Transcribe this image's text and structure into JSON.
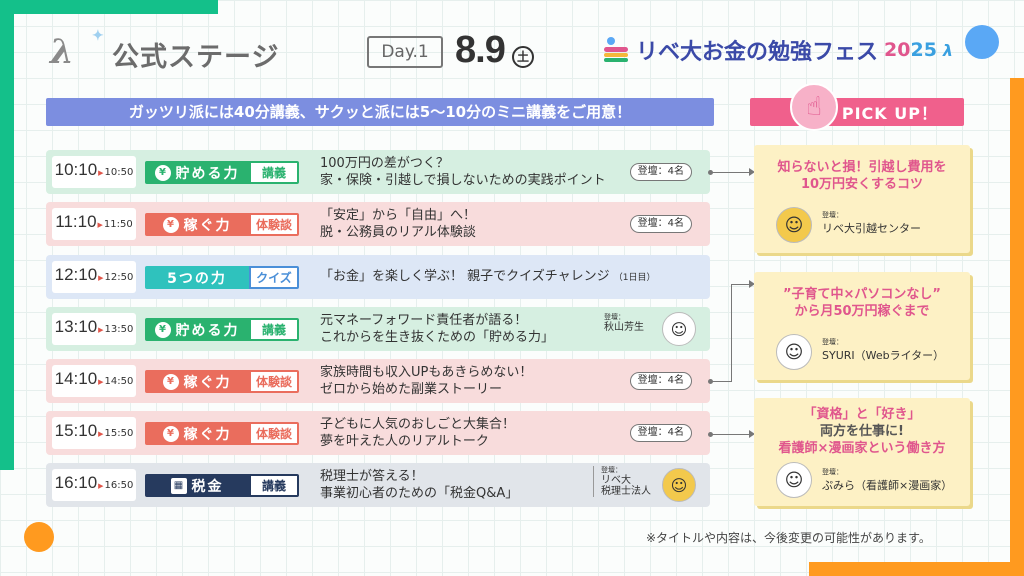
{
  "header": {
    "stage_title": "公式ステージ",
    "day_label": "Day.1",
    "date": "8.9",
    "weekday": "土",
    "festival_title": "リベ大お金の勉強フェス",
    "festival_year_a": "20",
    "festival_year_b": "25"
  },
  "banner": "ガッツリ派には40分講義、サクッと派には5〜10分のミニ講義をご用意！",
  "schedule": [
    {
      "start": "10:10",
      "end": "10:50",
      "category": "貯める力",
      "category_icon": "¥",
      "type": "講義",
      "title_line1": "100万円の差がつく？",
      "title_line2": "家・保険・引越しで損しないための実践ポイント",
      "speaker": "登壇：4名"
    },
    {
      "start": "11:10",
      "end": "11:50",
      "category": "稼ぐ力",
      "category_icon": "¥",
      "type": "体験談",
      "title_line1": "「安定」から「自由」へ！",
      "title_line2": "脱・公務員のリアル体験談",
      "speaker": "登壇：4名"
    },
    {
      "start": "12:10",
      "end": "12:50",
      "category": "5つの力",
      "type": "クイズ",
      "title_line1": "「お金」を楽しく学ぶ！ 親子でクイズチャレンジ",
      "title_note": "（1日目）"
    },
    {
      "start": "13:10",
      "end": "13:50",
      "category": "貯める力",
      "category_icon": "¥",
      "type": "講義",
      "title_line1": "元マネーフォワード責任者が語る！",
      "title_line2": "これからを生き抜くための「貯める力」",
      "speaker_label": "登壇：",
      "speaker_name": "秋山芳生"
    },
    {
      "start": "14:10",
      "end": "14:50",
      "category": "稼ぐ力",
      "category_icon": "¥",
      "type": "体験談",
      "title_line1": "家族時間も収入UPもあきらめない！",
      "title_line2": "ゼロから始めた副業ストーリー",
      "speaker": "登壇：4名"
    },
    {
      "start": "15:10",
      "end": "15:50",
      "category": "稼ぐ力",
      "category_icon": "¥",
      "type": "体験談",
      "title_line1": "子どもに人気のおしごと大集合！",
      "title_line2": "夢を叶えた人のリアルトーク",
      "speaker": "登壇：4名"
    },
    {
      "start": "16:10",
      "end": "16:50",
      "category": "税金",
      "category_icon": "▦",
      "type": "講義",
      "title_line1": "税理士が答える！",
      "title_line2": "事業初心者のための「税金Q&A」",
      "speaker_label": "登壇：",
      "speaker_name_line1": "リベ大",
      "speaker_name_line2": "税理士法人"
    }
  ],
  "pickup": {
    "header": "PICK UP！",
    "cards": [
      {
        "title_line1": "知らないと損！引越し費用を",
        "title_line2": "10万円安くするコツ",
        "speaker_label": "登壇：",
        "speaker_name": "リベ大引越センター"
      },
      {
        "title_line1": "”子育て中×パソコンなし”",
        "title_line2": "から月50万円稼ぐまで",
        "speaker_label": "登壇：",
        "speaker_name": "SYURI（Webライター）"
      },
      {
        "title_line1": "「資格」と「好き」",
        "title_line2": "両方を仕事に!",
        "title_line3": "看護師×漫画家という働き方",
        "speaker_label": "登壇：",
        "speaker_name": "ぷみら（看護師×漫画家）"
      }
    ]
  },
  "footnote": "※タイトルや内容は、今後変更の可能性があります。",
  "colors": {
    "green": "#2ab26f",
    "red": "#ea6d5d",
    "teal": "#2fc2bd",
    "navy": "#263a5e",
    "banner": "#7c8ee0",
    "pink": "#f0608c",
    "orange": "#ff9a1f"
  }
}
